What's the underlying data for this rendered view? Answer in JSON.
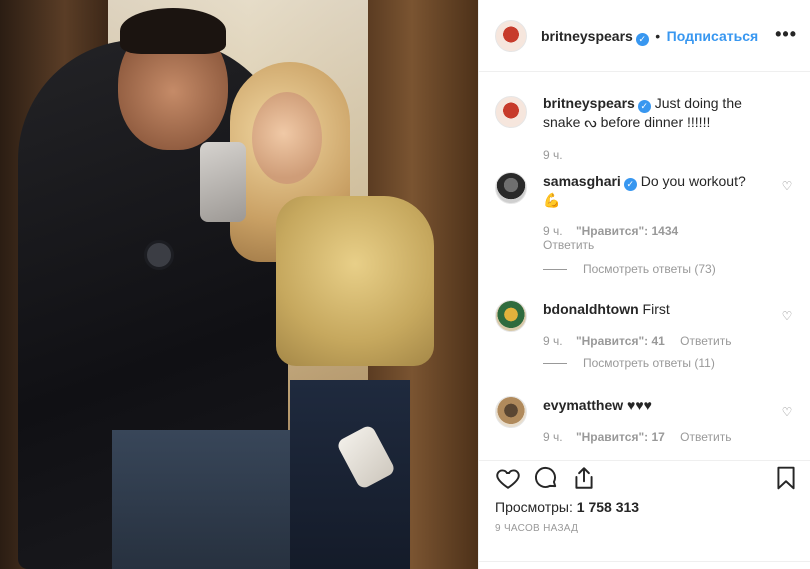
{
  "post": {
    "username": "britneyspears",
    "verified_icon": "verified-badge-icon",
    "follow_label": "Подписаться",
    "more_label": "•••",
    "caption": "Just doing the snake ᔓ before dinner !!!!!!",
    "caption_time": "9 ч.",
    "views_label": "Просмотры:",
    "views_count": "1 758 313",
    "posted_ago": "9 ЧАСОВ НАЗАД"
  },
  "comments": [
    {
      "username": "samasghari",
      "verified": true,
      "text": "Do you workout?",
      "emoji": "💪",
      "time": "9 ч.",
      "likes": "\"Нравится\": 1434",
      "reply_label": "Ответить",
      "view_replies": "Посмотреть ответы (73)"
    },
    {
      "username": "bdonaldhtown",
      "verified": false,
      "text": "First",
      "time": "9 ч.",
      "likes": "\"Нравится\": 41",
      "reply_label": "Ответить",
      "view_replies": "Посмотреть ответы (11)"
    },
    {
      "username": "evymatthew",
      "verified": false,
      "text": "♥♥♥",
      "time": "9 ч.",
      "likes": "\"Нравится\": 17",
      "reply_label": "Ответить"
    }
  ],
  "icons": {
    "like": "heart-icon",
    "comment": "comment-icon",
    "share": "share-icon",
    "save": "bookmark-icon"
  },
  "colors": {
    "accent": "#3897f0",
    "muted": "#999999",
    "border": "#efefef"
  }
}
